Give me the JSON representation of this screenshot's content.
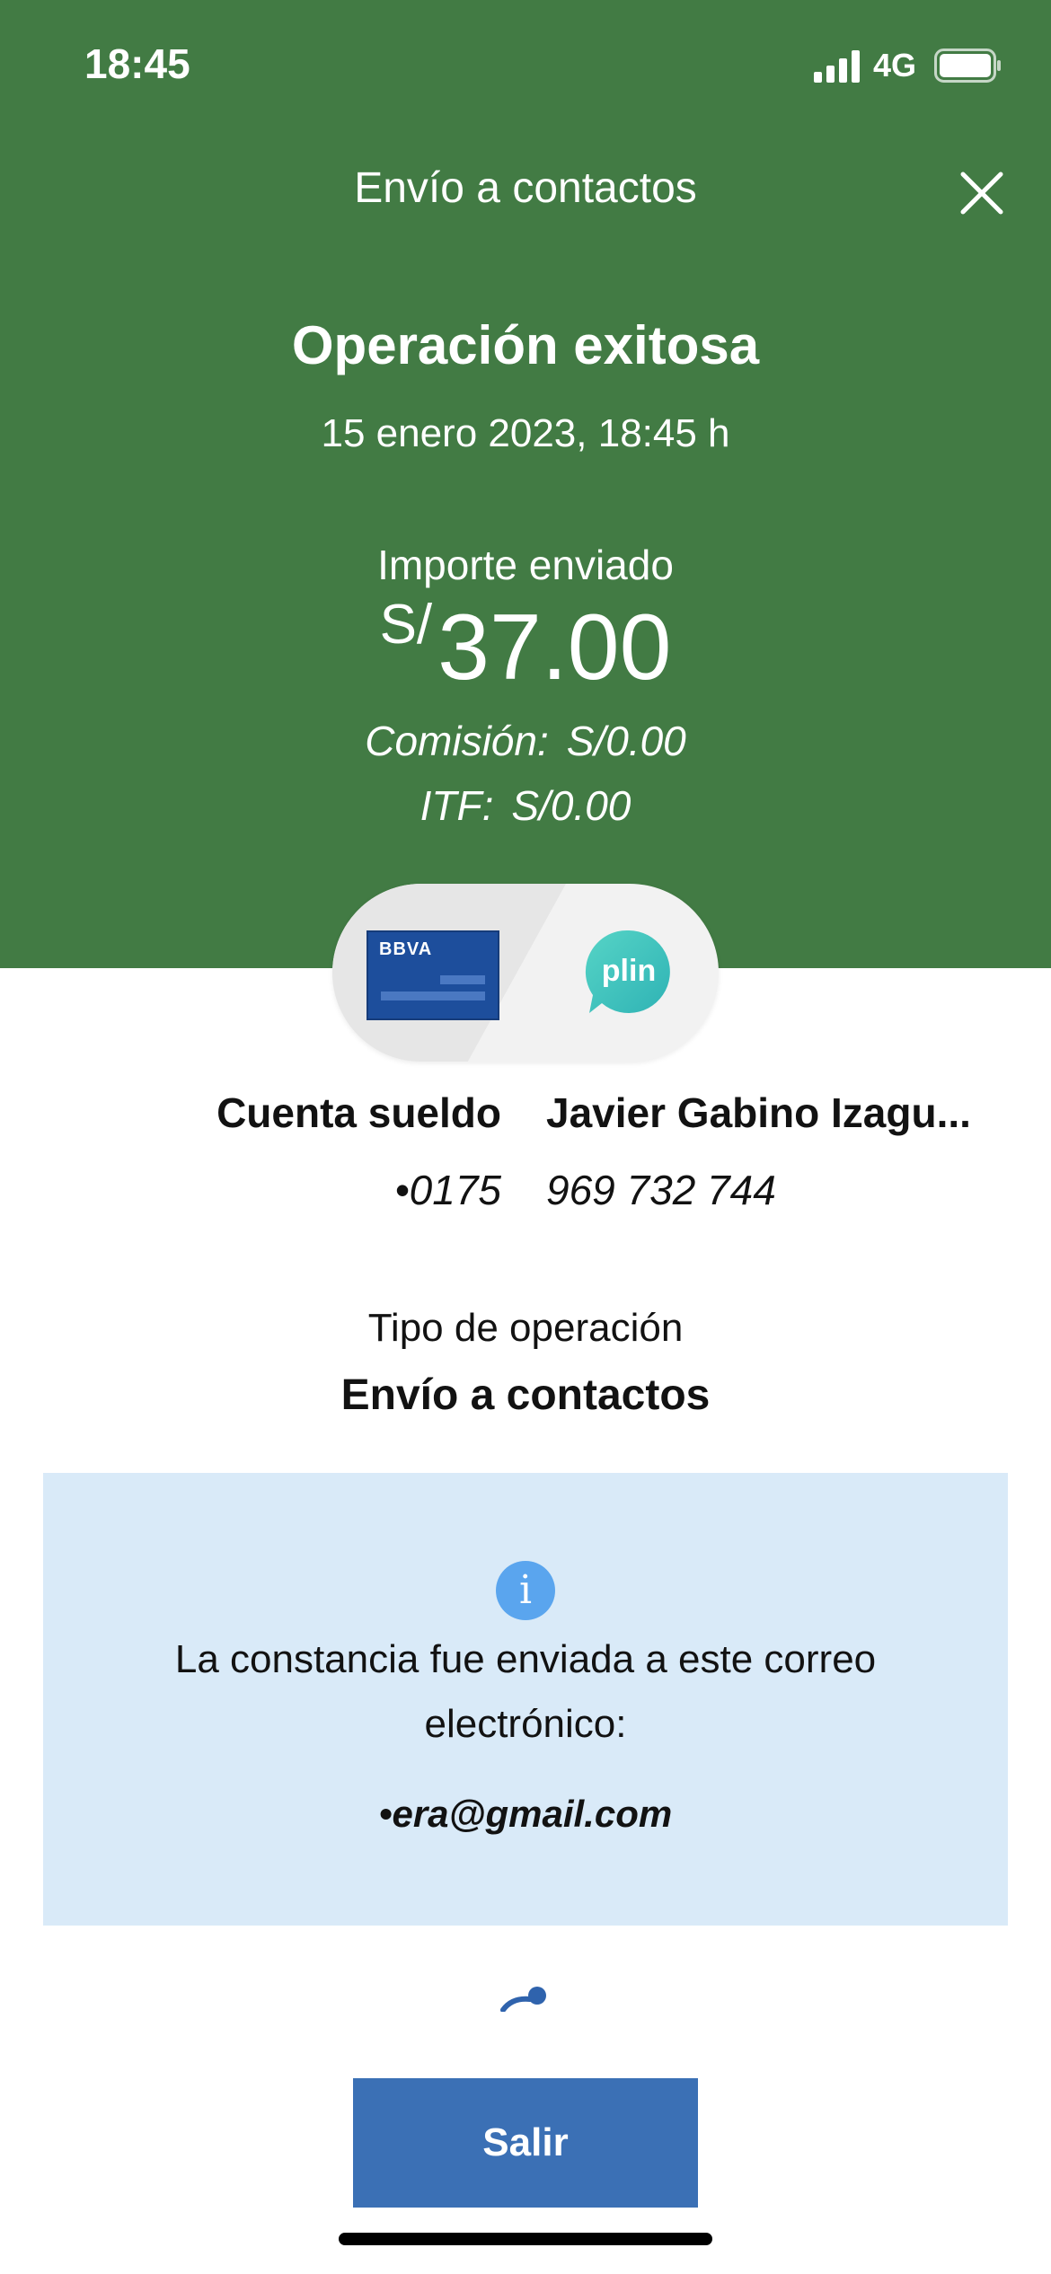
{
  "status_bar": {
    "time": "18:45",
    "network": "4G"
  },
  "header": {
    "title": "Envío a contactos"
  },
  "result": {
    "title": "Operación exitosa",
    "date": "15 enero 2023, 18:45 h",
    "amount_label": "Importe enviado",
    "amount_currency": "S/",
    "amount_value": "37.00",
    "commission_label": "Comisión:",
    "commission_value": "S/0.00",
    "itf_label": "ITF:",
    "itf_value": "S/0.00"
  },
  "transfer": {
    "card_brand": "BBVA",
    "from_name": "Cuenta sueldo",
    "from_number": "•0175",
    "to_name": "Javier Gabino Izagu...",
    "to_number": "969 732 744",
    "to_logo_text": "plin"
  },
  "operation": {
    "type_label": "Tipo de operación",
    "type_value": "Envío a contactos"
  },
  "notice": {
    "icon_text": "i",
    "text": "La constancia fue enviada a este correo electrónico:",
    "email": "•era@gmail.com"
  },
  "footer": {
    "exit_label": "Salir"
  },
  "colors": {
    "header_bg": "#427b44",
    "notice_bg": "#d9eaf8",
    "button_bg": "#3b70b5",
    "plin": "#3dc6bd"
  }
}
